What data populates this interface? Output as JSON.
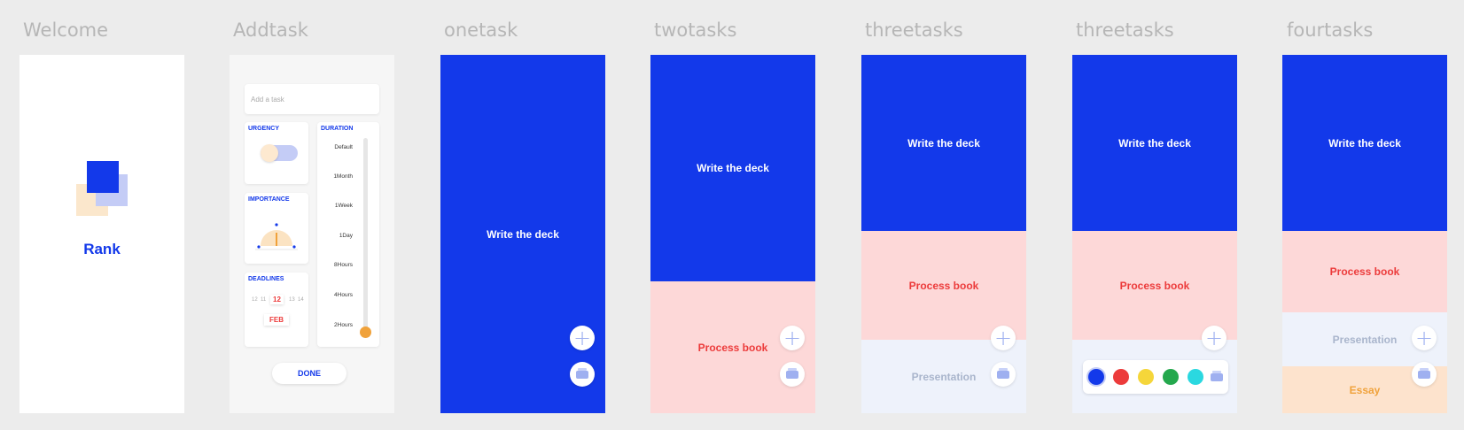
{
  "frames": {
    "welcome": {
      "title": "Welcome",
      "app_name": "Rank"
    },
    "addtask": {
      "title": "Addtask",
      "task_placeholder": "Add a task",
      "urgency_label": "URGENCY",
      "importance_label": "IMPORTANCE",
      "deadlines_label": "DEADLINES",
      "duration_label": "DURATION",
      "durations": [
        "Default",
        "1Month",
        "1Week",
        "1Day",
        "8Hours",
        "4Hours",
        "2Hours"
      ],
      "days": [
        "12",
        "11",
        "12",
        "13",
        "14"
      ],
      "month": "FEB",
      "done_label": "DONE"
    },
    "onetask": {
      "title": "onetask",
      "tasks": [
        "Write the deck"
      ]
    },
    "twotasks": {
      "title": "twotasks",
      "tasks": [
        "Write the deck",
        "Process book"
      ]
    },
    "threetasks": {
      "title": "threetasks",
      "tasks": [
        "Write the deck",
        "Process book",
        "Presentation"
      ]
    },
    "threetasks_colors": {
      "title": "threetasks",
      "tasks": [
        "Write the deck",
        "Process book"
      ],
      "swatches": [
        "#1339ea",
        "#ec3b3b",
        "#f5d63a",
        "#24a84d",
        "#2ad8e0"
      ]
    },
    "fourtasks": {
      "title": "fourtasks",
      "tasks": [
        "Write the deck",
        "Process book",
        "Presentation",
        "Essay"
      ]
    }
  },
  "colors": {
    "blue": "#1339ea",
    "pink": "#fdd8d8",
    "red": "#ec3b3b",
    "pale": "#eef2fb",
    "peach": "#fde3cd",
    "orange": "#f0a23b"
  },
  "icons": {
    "add": "plus-icon",
    "tag": "tag-icon"
  }
}
